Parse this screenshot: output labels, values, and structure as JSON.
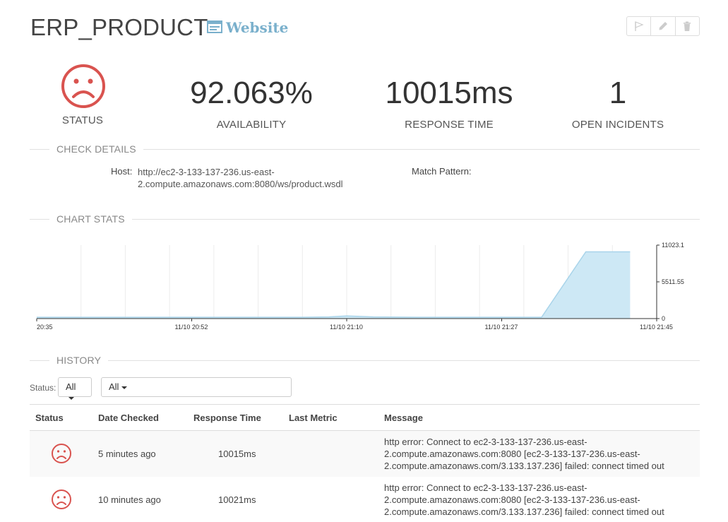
{
  "header": {
    "title": "ERP_PRODUCT",
    "type_label": "Website",
    "type_icon": "window-icon",
    "actions": [
      {
        "name": "flag-icon"
      },
      {
        "name": "pencil-icon"
      },
      {
        "name": "trash-icon"
      }
    ]
  },
  "stats": {
    "status_label": "STATUS",
    "status_icon": "sad-face-icon",
    "availability_value": "92.063%",
    "availability_label": "AVAILABILITY",
    "response_value": "10015ms",
    "response_label": "RESPONSE TIME",
    "incidents_value": "1",
    "incidents_label": "OPEN INCIDENTS"
  },
  "check_details": {
    "section_title": "CHECK DETAILS",
    "host_key": "Host:",
    "host_line1": "http://ec2-3-133-137-236.us-east-",
    "host_line2": "2.compute.amazonaws.com:8080/ws/product.wsdl",
    "match_key": "Match Pattern:",
    "match_value": ""
  },
  "chart_stats": {
    "section_title": "CHART STATS"
  },
  "chart_data": {
    "type": "area",
    "title": "",
    "xlabel": "",
    "ylabel": "",
    "x_ticks": [
      "20:35",
      "11/10 20:52",
      "11/10 21:10",
      "11/10 21:27",
      "11/10 21:45"
    ],
    "y_ticks": [
      "0",
      "5511.55",
      "11023.1"
    ],
    "ylim": [
      0,
      11023.1
    ],
    "grid": "vertical",
    "series": [
      {
        "values": [
          [
            "20:35",
            200
          ],
          [
            "20:40",
            200
          ],
          [
            "20:45",
            200
          ],
          [
            "20:50",
            200
          ],
          [
            "20:55",
            200
          ],
          [
            "21:00",
            200
          ],
          [
            "21:05",
            200
          ],
          [
            "21:08",
            250
          ],
          [
            "21:10",
            400
          ],
          [
            "21:13",
            250
          ],
          [
            "21:18",
            200
          ],
          [
            "21:25",
            200
          ],
          [
            "21:32",
            200
          ],
          [
            "21:37",
            10021
          ],
          [
            "21:42",
            10015
          ]
        ]
      }
    ],
    "color": "#a9d4ea"
  },
  "history": {
    "section_title": "HISTORY",
    "status_filter_label": "Status:",
    "status_filter_value": "All",
    "second_filter_value": "All",
    "columns": [
      "Status",
      "Date Checked",
      "Response Time",
      "Last Metric",
      "Message"
    ],
    "rows": [
      {
        "status_icon": "sad-face-icon",
        "date": "5 minutes ago",
        "response": "10015ms",
        "last_metric": "",
        "message_l1": "http error: Connect to ec2-3-133-137-236.us-east-",
        "message_l2": "2.compute.amazonaws.com:8080 [ec2-3-133-137-236.us-east-",
        "message_l3": "2.compute.amazonaws.com/3.133.137.236] failed: connect timed out"
      },
      {
        "status_icon": "sad-face-icon",
        "date": "10 minutes ago",
        "response": "10021ms",
        "last_metric": "",
        "message_l1": "http error: Connect to ec2-3-133-137-236.us-east-",
        "message_l2": "2.compute.amazonaws.com:8080 [ec2-3-133-137-236.us-east-",
        "message_l3": "2.compute.amazonaws.com/3.133.137.236] failed: connect timed out"
      }
    ]
  },
  "colors": {
    "sad_face": "#d9534f",
    "type_label": "#7ab0cc",
    "chart_fill": "#cde8f5",
    "chart_line": "#a9d4ea"
  }
}
